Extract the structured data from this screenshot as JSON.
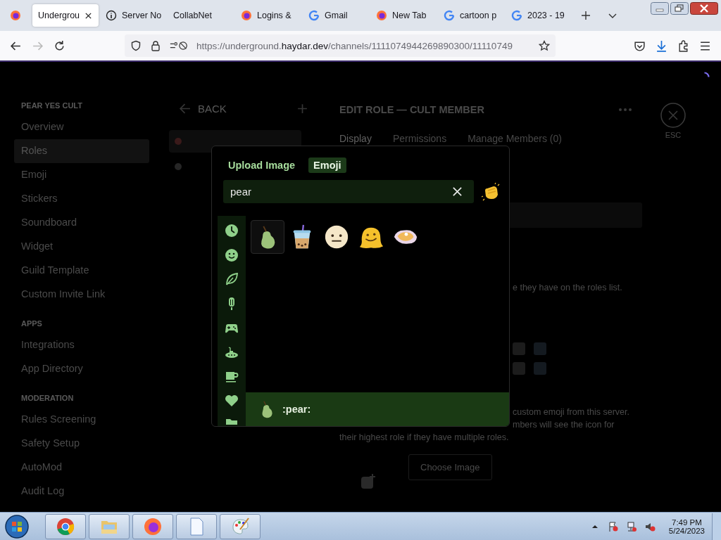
{
  "browser": {
    "tabs": [
      {
        "kind": "firefox",
        "selected": false
      },
      {
        "kind": "plain",
        "title": "Undergrou",
        "selected": true
      },
      {
        "kind": "info",
        "title": "Server No",
        "selected": false
      },
      {
        "kind": "plain",
        "title": "CollabNet",
        "selected": false
      },
      {
        "kind": "firefox",
        "title": "Logins &",
        "selected": false
      },
      {
        "kind": "google",
        "title": "Gmail",
        "selected": false
      },
      {
        "kind": "firefox",
        "title": "New Tab",
        "selected": false
      },
      {
        "kind": "google",
        "title": "cartoon p",
        "selected": false
      },
      {
        "kind": "google",
        "title": "2023 - 19",
        "selected": false
      }
    ],
    "url_host_prefix": "https://underground.",
    "url_host": "haydar.dev",
    "url_path": "/channels/1111074944269890300/11110749"
  },
  "settings": {
    "sections": [
      {
        "header": "PEAR YES CULT",
        "items": [
          {
            "label": "Overview",
            "selected": false
          },
          {
            "label": "Roles",
            "selected": true
          },
          {
            "label": "Emoji",
            "selected": false
          },
          {
            "label": "Stickers",
            "selected": false
          },
          {
            "label": "Soundboard",
            "selected": false
          },
          {
            "label": "Widget",
            "selected": false
          },
          {
            "label": "Guild Template",
            "selected": false
          },
          {
            "label": "Custom Invite Link",
            "selected": false
          }
        ]
      },
      {
        "header": "APPS",
        "items": [
          {
            "label": "Integrations",
            "selected": false
          },
          {
            "label": "App Directory",
            "selected": false
          }
        ]
      },
      {
        "header": "MODERATION",
        "items": [
          {
            "label": "Rules Screening",
            "selected": false
          },
          {
            "label": "Safety Setup",
            "selected": false
          },
          {
            "label": "AutoMod",
            "selected": false
          },
          {
            "label": "Audit Log",
            "selected": false
          }
        ]
      }
    ],
    "back": "BACK",
    "roles": [
      {
        "color": "#3a1a1a",
        "selected": true
      },
      {
        "color": "#262626",
        "selected": false
      }
    ],
    "title": "EDIT ROLE — CULT MEMBER",
    "tabs": [
      {
        "label": "Display",
        "selected": true
      },
      {
        "label": "Permissions",
        "selected": false
      },
      {
        "label": "Manage Members (0)",
        "selected": false
      }
    ],
    "close_label": "ESC",
    "fragment_1": "e they have on the roles list.",
    "fragment_2": "custom emoji from this server.",
    "fragment_3": "mbers will see the icon for",
    "fragment_4": "their highest role if they have multiple roles.",
    "choose_button": "Choose Image"
  },
  "picker": {
    "tabs": [
      {
        "label": "Upload Image",
        "selected": false
      },
      {
        "label": "Emoji",
        "selected": true
      }
    ],
    "search": {
      "value": "pear"
    },
    "categories": [
      {
        "kind": "recent"
      },
      {
        "kind": "people"
      },
      {
        "kind": "nature"
      },
      {
        "kind": "food"
      },
      {
        "kind": "activities"
      },
      {
        "kind": "travel"
      },
      {
        "kind": "objects"
      },
      {
        "kind": "symbols"
      },
      {
        "kind": "flags"
      }
    ],
    "results": [
      {
        "kind": "pear",
        "selected": true
      },
      {
        "kind": "bubble_tea",
        "selected": false
      },
      {
        "kind": "neutral_face",
        "selected": false
      },
      {
        "kind": "melting_face",
        "selected": false
      },
      {
        "kind": "oyster",
        "selected": false
      }
    ],
    "preview": {
      "kind": "pear",
      "name": ":pear:"
    }
  },
  "taskbar": {
    "apps": [
      {
        "kind": "chrome"
      },
      {
        "kind": "explorer"
      },
      {
        "kind": "firefox"
      },
      {
        "kind": "document"
      },
      {
        "kind": "paint"
      }
    ],
    "time": "7:49 PM",
    "date": "5/24/2023"
  }
}
